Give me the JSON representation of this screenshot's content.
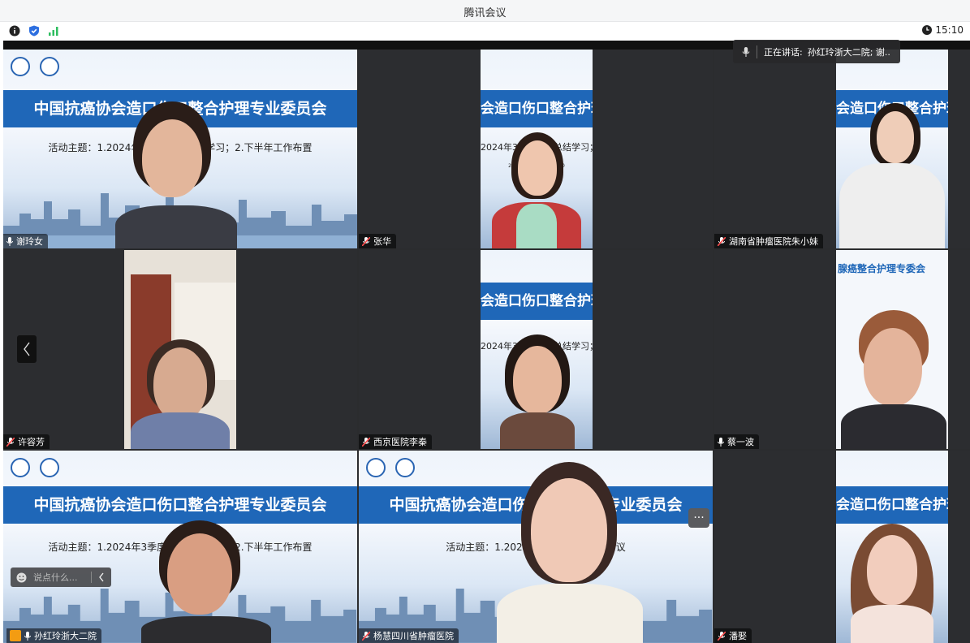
{
  "window": {
    "title": "腾讯会议"
  },
  "status": {
    "time": "15:10"
  },
  "speaking": {
    "label": "正在讲话:",
    "name": "孙红玲浙大二院; 谢.."
  },
  "slide_text": {
    "title_full": "中国抗癌协会造口伤口整合护理专业委员会",
    "title_partial": "会造口伤口整合护理",
    "subtitle_full": "活动主题：1.2024年3季度工作总结学习；2.下半年工作布置",
    "subtitle_partial": "2024年3季度工作总结学习；2.",
    "date_line": "2024年8月 19:30-20:30",
    "breast_title": "腺癌整合护理专委会",
    "subtitle_partial2": "活动主题：1.2024年1季度工作总结 会议"
  },
  "participants": [
    {
      "name": "谢玲女",
      "mic": "on"
    },
    {
      "name": "张华",
      "mic": "off"
    },
    {
      "name": "湖南省肿瘤医院朱小妹",
      "mic": "off"
    },
    {
      "name": "许容芳",
      "mic": "off"
    },
    {
      "name": "西京医院李秦",
      "mic": "off"
    },
    {
      "name": "蔡一波",
      "mic": "on"
    },
    {
      "name": "孙红玲浙大二院",
      "mic": "on"
    },
    {
      "name": "杨慧四川省肿瘤医院",
      "mic": "off"
    },
    {
      "name": "潘娶",
      "mic": "off"
    }
  ],
  "chat": {
    "placeholder": "说点什么..."
  },
  "colors": {
    "active_border": "#2ecc71",
    "slide_blue": "#1f67b8",
    "tile_bg": "#2c2d30"
  }
}
